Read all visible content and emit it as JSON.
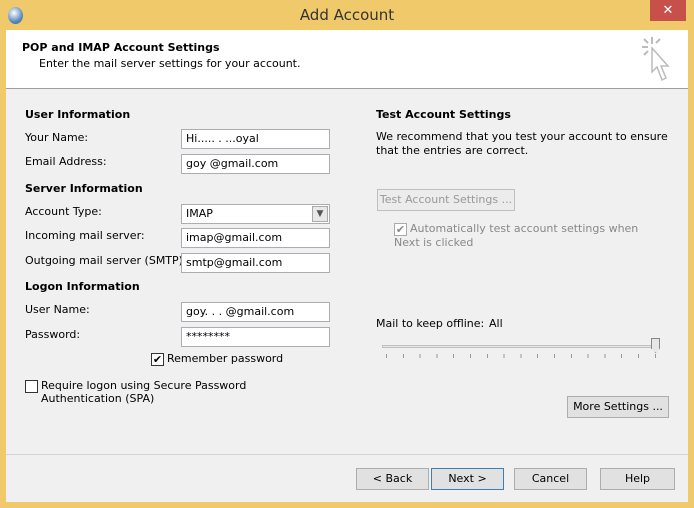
{
  "window": {
    "title": "Add Account",
    "close": "✕"
  },
  "header": {
    "title": "POP and IMAP Account Settings",
    "subtitle": "Enter the mail server settings for your account."
  },
  "user_info": {
    "heading": "User Information",
    "name_label": "Your Name:",
    "name_value": "Hi.....   . ...oyal",
    "email_label": "Email Address:",
    "email_value": "goy          @gmail.com"
  },
  "server_info": {
    "heading": "Server Information",
    "type_label": "Account Type:",
    "type_value": "IMAP",
    "incoming_label": "Incoming mail server:",
    "incoming_value": "imap@gmail.com",
    "outgoing_label": "Outgoing mail server (SMTP):",
    "outgoing_value": "smtp@gmail.com"
  },
  "logon_info": {
    "heading": "Logon Information",
    "user_label": "User Name:",
    "user_value": "goy.   .  .   @gmail.com",
    "password_label": "Password:",
    "password_value": "********",
    "remember_label": "Remember password",
    "remember_checked": true,
    "spa_label": "Require logon using Secure Password Authentication (SPA)",
    "spa_checked": false
  },
  "test": {
    "heading": "Test Account Settings",
    "description": "We recommend that you test your account to ensure that the entries are correct.",
    "button": "Test Account Settings ...",
    "auto_label": "Automatically test account settings when Next is clicked",
    "auto_checked": true
  },
  "offline": {
    "label": "Mail to keep offline:",
    "value": "All",
    "slider_fraction": 1.0
  },
  "more_settings": "More Settings ...",
  "footer": {
    "back": "< Back",
    "next": "Next >",
    "cancel": "Cancel",
    "help": "Help"
  }
}
